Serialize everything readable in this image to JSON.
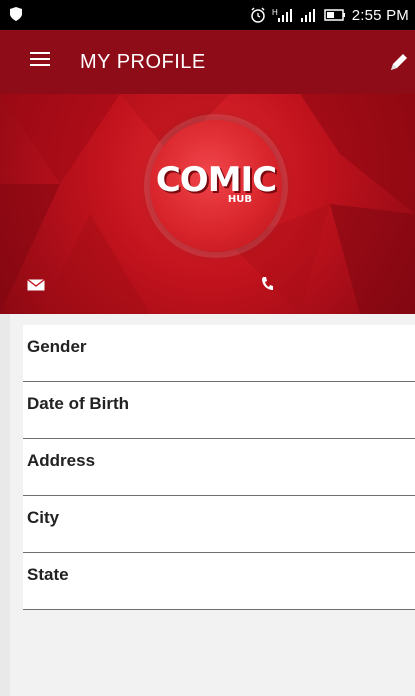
{
  "status_bar": {
    "time": "2:55 PM",
    "icons": [
      "shield-icon",
      "alarm-icon",
      "signal-h-icon",
      "signal-icon",
      "battery-icon"
    ]
  },
  "app_bar": {
    "title": "MY PROFILE",
    "menu_icon": "hamburger-menu-icon",
    "edit_icon": "pencil-icon"
  },
  "profile": {
    "logo_main": "COMIC",
    "logo_sub": "HUB",
    "contact_icons": [
      "mail-icon",
      "phone-icon"
    ]
  },
  "fields": [
    {
      "label": "Gender"
    },
    {
      "label": "Date of Birth"
    },
    {
      "label": "Address"
    },
    {
      "label": "City"
    },
    {
      "label": "State"
    }
  ],
  "colors": {
    "app_bar": "#8e0c18",
    "hero": "#c0121d",
    "background": "#f2f2f2"
  }
}
